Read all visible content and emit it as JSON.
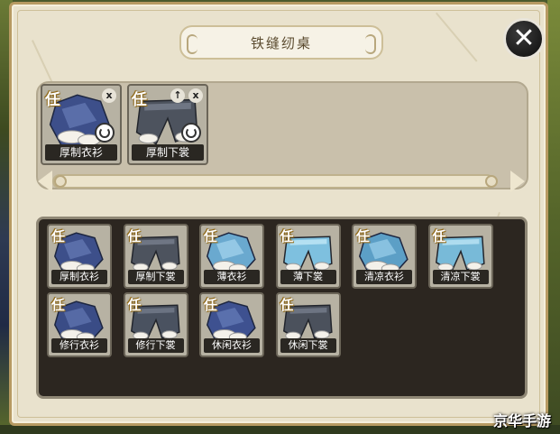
{
  "window": {
    "title": "铁缝纫桌"
  },
  "close_label": "✕",
  "selected_items": [
    {
      "badge": "任",
      "name": "厚制衣衫",
      "corner": "x",
      "type": "shirt",
      "color": "#3d4f8a",
      "accent": "#6275b0"
    },
    {
      "badge": "任",
      "name": "厚制下裳",
      "corner": "↑",
      "corner2": "x",
      "type": "pants",
      "color": "#4d535e",
      "accent": "#6f7684"
    }
  ],
  "inventory_items": [
    {
      "badge": "任",
      "name": "厚制衣衫",
      "type": "shirt",
      "color": "#3d4f8a",
      "accent": "#6275b0"
    },
    {
      "badge": "任",
      "name": "厚制下裳",
      "type": "pants",
      "color": "#4d535e",
      "accent": "#6f7684"
    },
    {
      "badge": "任",
      "name": "薄衣衫",
      "type": "shirt",
      "color": "#6aa9cf",
      "accent": "#9fd0ea"
    },
    {
      "badge": "任",
      "name": "薄下裳",
      "type": "pants",
      "color": "#7ec0df",
      "accent": "#b4e0f2"
    },
    {
      "badge": "任",
      "name": "清凉衣衫",
      "type": "shirt",
      "color": "#5c9fc6",
      "accent": "#94c9e6"
    },
    {
      "badge": "任",
      "name": "清凉下裳",
      "type": "pants",
      "color": "#78bad8",
      "accent": "#aedcef"
    },
    {
      "badge": "任",
      "name": "修行衣衫",
      "type": "shirt",
      "color": "#3a4c86",
      "accent": "#5e72ad"
    },
    {
      "badge": "任",
      "name": "修行下裳",
      "type": "pants",
      "color": "#4a5260",
      "accent": "#6b7382"
    },
    {
      "badge": "任",
      "name": "休闲衣衫",
      "type": "shirt",
      "color": "#3e5190",
      "accent": "#6278b4"
    },
    {
      "badge": "任",
      "name": "休闲下裳",
      "type": "pants",
      "color": "#4b515c",
      "accent": "#6d7482"
    }
  ],
  "watermark": "京华手游"
}
